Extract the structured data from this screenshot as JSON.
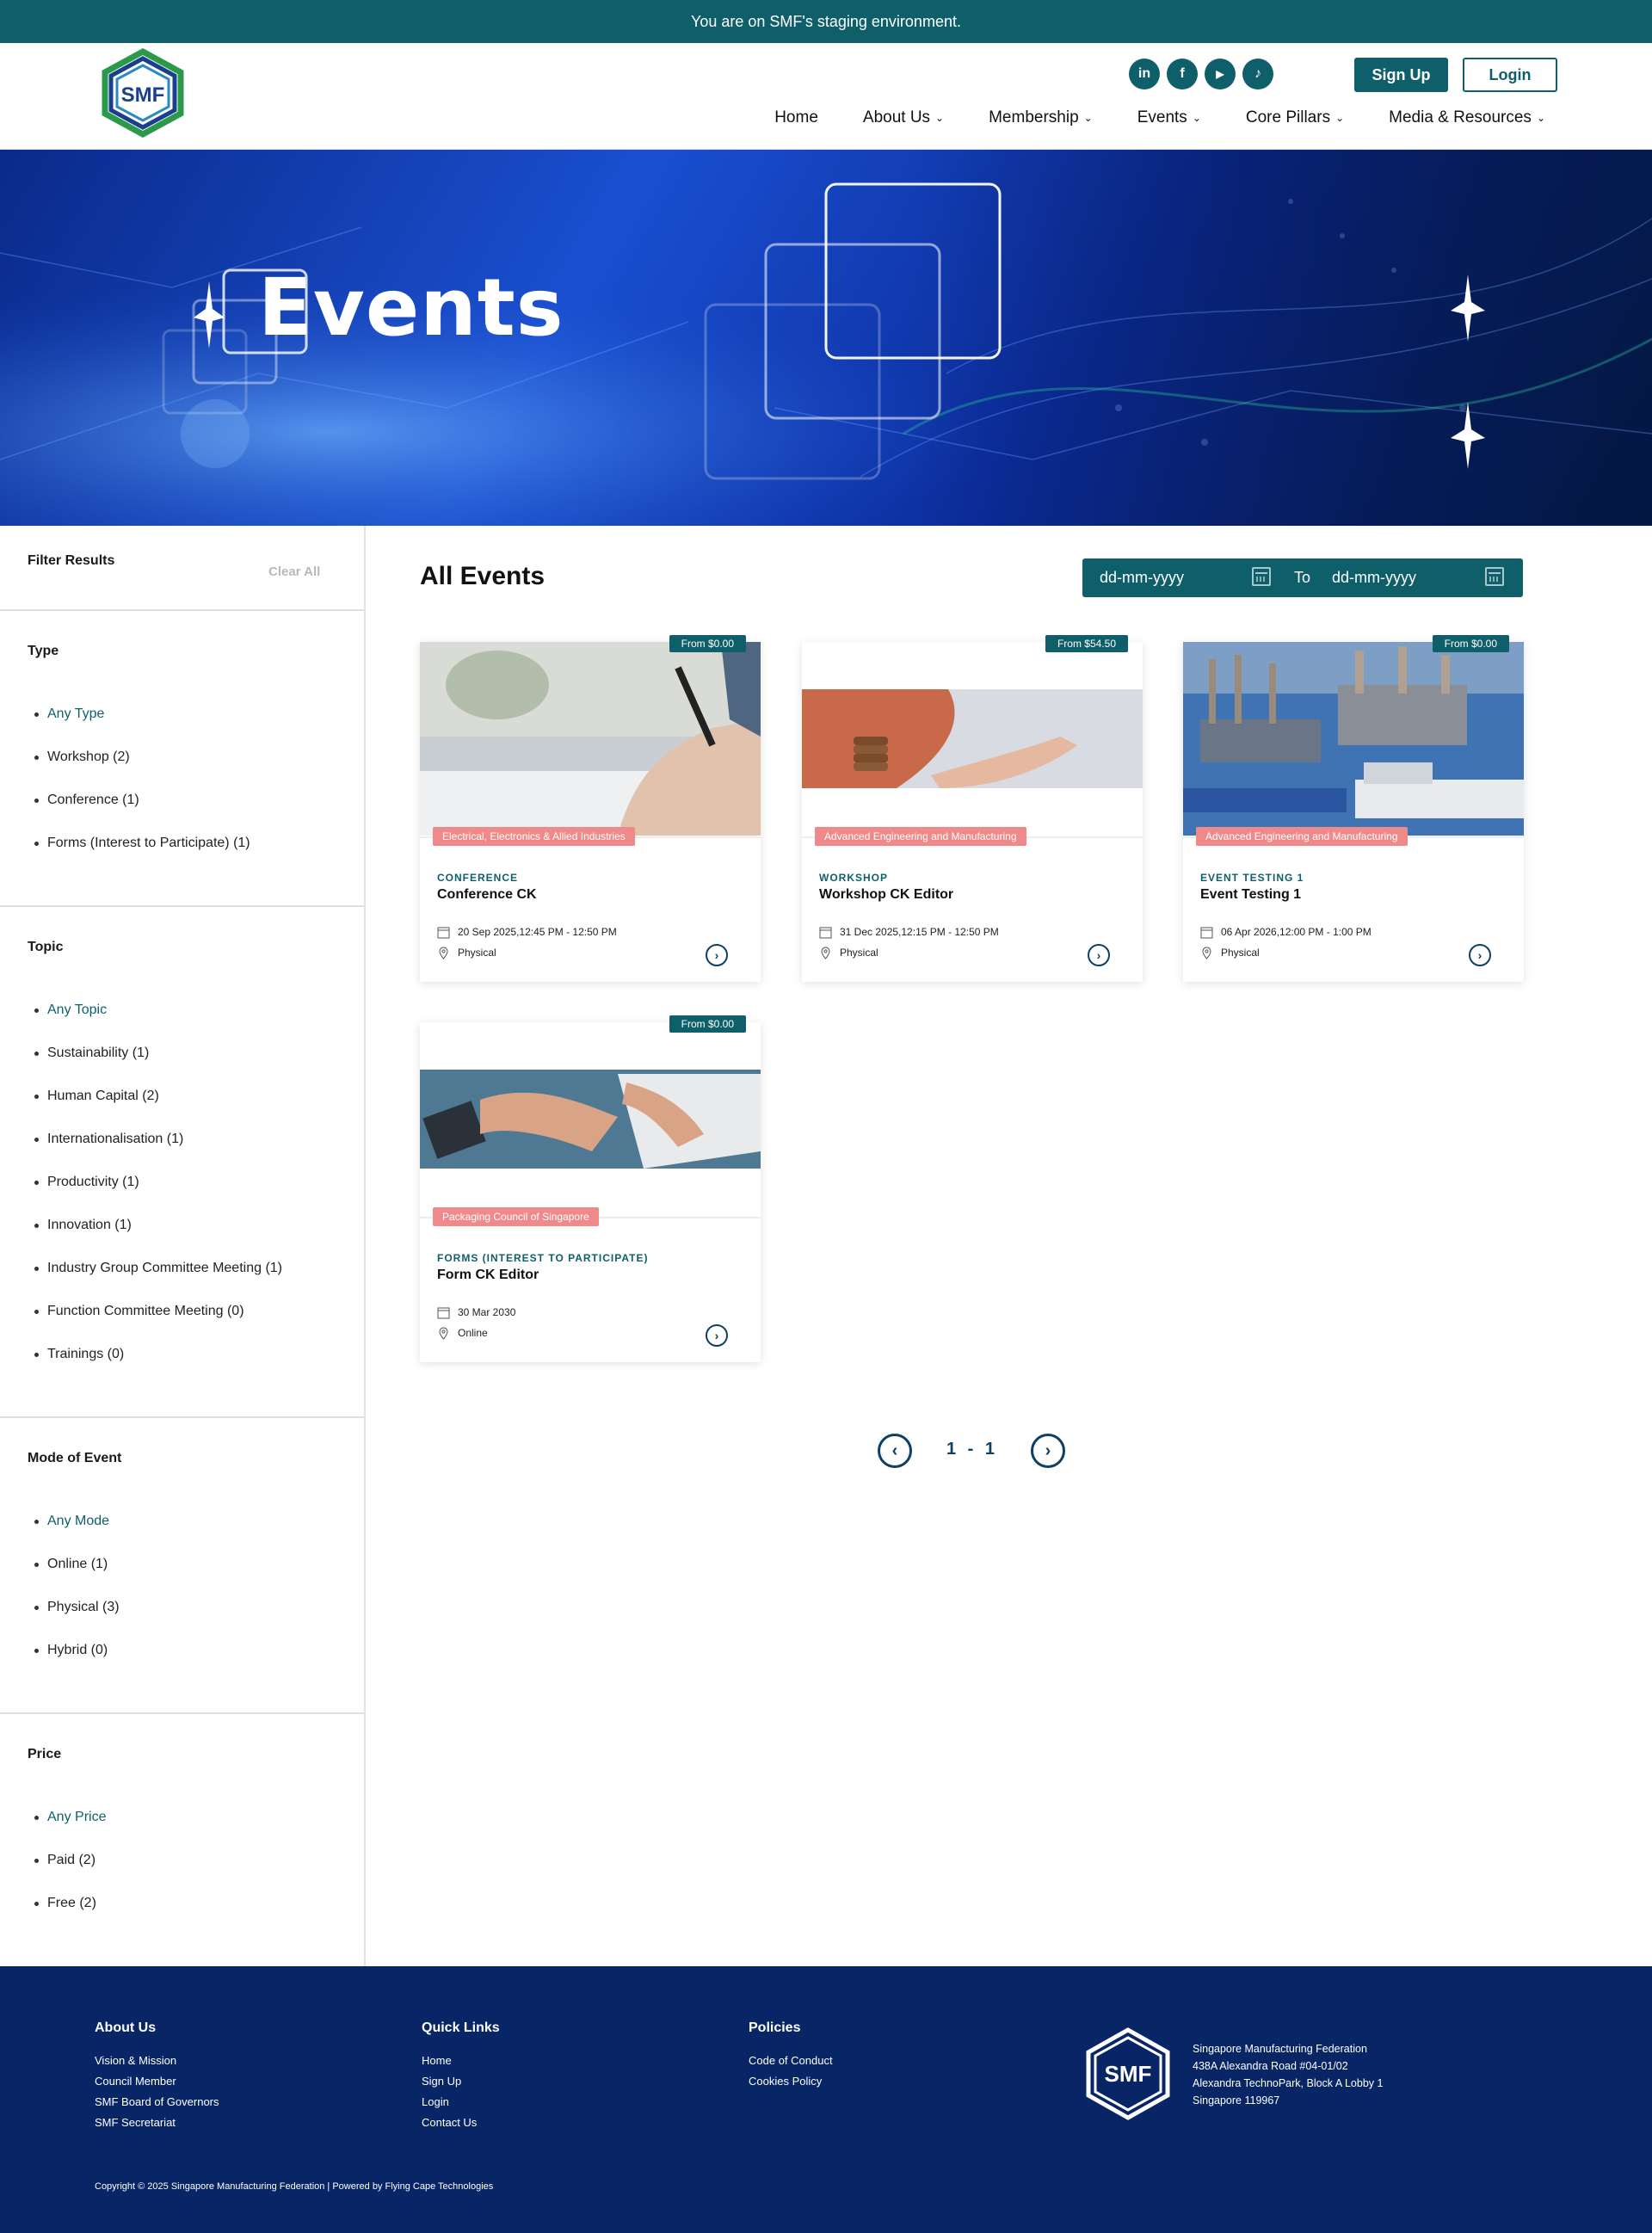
{
  "staging_banner": "You are on SMF's staging environment.",
  "header": {
    "logo_text": "SMF",
    "social": [
      "in",
      "f",
      "▶",
      "♪"
    ],
    "social_names": [
      "linkedin-icon",
      "facebook-icon",
      "youtube-icon",
      "tiktok-icon"
    ],
    "signup_label": "Sign Up",
    "login_label": "Login",
    "nav": [
      {
        "label": "Home",
        "has_dropdown": false
      },
      {
        "label": "About Us",
        "has_dropdown": true
      },
      {
        "label": "Membership",
        "has_dropdown": true
      },
      {
        "label": "Events",
        "has_dropdown": true
      },
      {
        "label": "Core Pillars",
        "has_dropdown": true
      },
      {
        "label": "Media & Resources",
        "has_dropdown": true
      }
    ]
  },
  "hero": {
    "title": "Events"
  },
  "filters": {
    "title": "Filter Results",
    "clear_all": "Clear All",
    "groups": [
      {
        "title": "Type",
        "options": [
          "Any Type",
          "Workshop (2)",
          "Conference (1)",
          "Forms (Interest to Participate) (1)"
        ]
      },
      {
        "title": "Topic",
        "options": [
          "Any Topic",
          "Sustainability (1)",
          "Human Capital (2)",
          "Internationalisation (1)",
          "Productivity (1)",
          "Innovation (1)",
          "Industry Group Committee Meeting (1)",
          "Function Committee Meeting (0)",
          "Trainings (0)"
        ]
      },
      {
        "title": "Mode of Event",
        "options": [
          "Any Mode",
          "Online (1)",
          "Physical (3)",
          "Hybrid (0)"
        ]
      },
      {
        "title": "Price",
        "options": [
          "Any Price",
          "Paid (2)",
          "Free (2)"
        ]
      }
    ]
  },
  "content": {
    "title": "All Events",
    "date_from_placeholder": "dd-mm-yyyy",
    "date_to_label": "To",
    "date_to_placeholder": "dd-mm-yyyy"
  },
  "events": [
    {
      "price": "From $0.00",
      "tag": "Electrical, Electronics & Allied Industries",
      "type": "CONFERENCE",
      "name": "Conference CK",
      "date": "20 Sep 2025,12:45 PM - 12:50 PM",
      "mode": "Physical",
      "image": "hand-writing-photo"
    },
    {
      "price": "From $54.50",
      "tag": "Advanced Engineering and Manufacturing",
      "type": "WORKSHOP",
      "name": "Workshop CK Editor",
      "date": "31 Dec 2025,12:15 PM - 12:50 PM",
      "mode": "Physical",
      "image": "coins-hand-photo"
    },
    {
      "price": "From $0.00",
      "tag": "Advanced Engineering and Manufacturing",
      "type": "EVENT TESTING 1",
      "name": "Event Testing 1",
      "date": "06 Apr 2026,12:00 PM - 1:00 PM",
      "mode": "Physical",
      "image": "offshore-rig-photo"
    },
    {
      "price": "From $0.00",
      "tag": "Packaging Council of Singapore",
      "type": "FORMS (INTEREST TO PARTICIPATE)",
      "name": "Form CK Editor",
      "date": "30 Mar 2030",
      "mode": "Online",
      "image": "calculator-desk-photo"
    }
  ],
  "pagination": {
    "text": "1 - 1"
  },
  "footer": {
    "about": {
      "title": "About Us",
      "items": [
        "Vision & Mission",
        "Council Member",
        "SMF Board of Governors",
        "SMF Secretariat"
      ]
    },
    "quick": {
      "title": "Quick Links",
      "items": [
        "Home",
        "Sign Up",
        "Login",
        "Contact Us"
      ]
    },
    "policies": {
      "title": "Policies",
      "items": [
        "Code of Conduct",
        "Cookies Policy"
      ]
    },
    "logo_text": "SMF",
    "address": [
      "Singapore Manufacturing Federation",
      "438A Alexandra Road #04-01/02",
      "Alexandra TechnoPark, Block A Lobby 1",
      "Singapore 119967"
    ],
    "copyright": "Copyright © 2025 Singapore Manufacturing Federation | Powered by Flying Cape Technologies"
  },
  "colors": {
    "primary": "#0f5f6b",
    "footer_bg": "#082566",
    "tag_bg": "#f08a8a",
    "navy": "#0f3f63"
  }
}
